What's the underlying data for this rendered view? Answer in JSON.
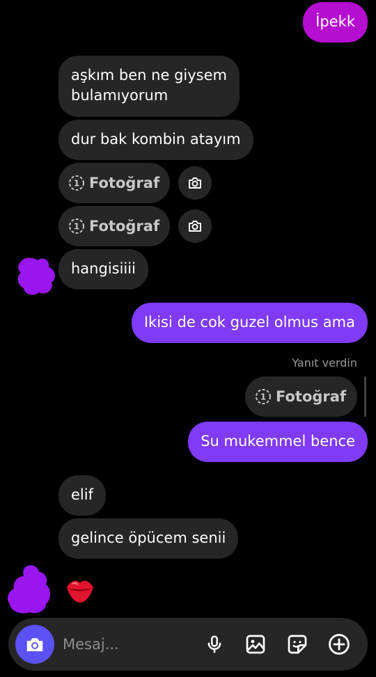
{
  "colors": {
    "incoming_bubble": "#262626",
    "outgoing_purple": "#7f3bf5",
    "outgoing_magenta": "#b50ed0",
    "camera_button": "#5b51f5",
    "background": "#000000"
  },
  "messages": [
    {
      "direction": "out",
      "text": "İpekk"
    },
    {
      "direction": "in",
      "text_line1": "aşkım ben ne giysem",
      "text_line2": "bulamıyorum"
    },
    {
      "direction": "in",
      "text": "dur bak kombin atayım"
    },
    {
      "direction": "in",
      "type": "view-once-photo",
      "label": "Fotoğraf"
    },
    {
      "direction": "in",
      "type": "view-once-photo",
      "label": "Fotoğraf"
    },
    {
      "direction": "in",
      "text": "hangisiiii"
    },
    {
      "direction": "out",
      "text": "Ikisi de cok guzel olmus ama"
    },
    {
      "direction": "out",
      "type": "reply",
      "reply_label": "Yanıt verdin",
      "quoted_label": "Fotoğraf"
    },
    {
      "direction": "out",
      "text": "Su mukemmel bence"
    },
    {
      "direction": "in",
      "text": "elif"
    },
    {
      "direction": "in",
      "text": "gelince öpücem senii"
    },
    {
      "direction": "in",
      "type": "emoji",
      "text": "💋",
      "icon": "kiss-lips-icon"
    }
  ],
  "composer": {
    "placeholder": "Mesaj...",
    "value": "",
    "icons": [
      "camera-icon",
      "microphone-icon",
      "gallery-icon",
      "sticker-icon",
      "plus-circle-icon"
    ]
  }
}
